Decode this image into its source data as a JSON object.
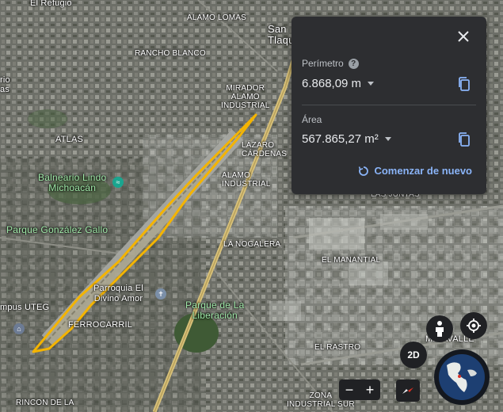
{
  "map_labels": {
    "el_refugio": "El Refugio",
    "alamo_lomas": "ALAMO LOMAS",
    "san_tlaque": "San\nTlaque",
    "rancho_blanco": "RANCHO BLANCO",
    "rio_left": "rio\nas",
    "mirador": "MIRADOR\nALAMO\nINDUSTRIAL",
    "atlas": "ATLAS",
    "lazaro": "LÁZARO\nCÁRDENAS",
    "alamo_industrial": "ALAMO\nINDUSTRIAL",
    "balneario": "Balneario Lindo\nMichoacán",
    "parque_gonzalez": "Parque González Gallo",
    "la_nogalera": "LA NOGALERA",
    "el_manantial": "EL MANANTIAL",
    "las_juntas": "LAS JUNTAS",
    "parroquia": "Parroquia El\nDivino Amor",
    "parque_liberacion": "Parque de La\nLiberación",
    "campus_uteg": "mpus UTEG",
    "ferrocarril": "FERROCARRIL",
    "miravalle": "MIRAVALLE",
    "el_rastro": "EL RASTRO",
    "zona_industrial": "ZONA\nINDUSTRIAL SUR",
    "rincon": "RINCON DE LA"
  },
  "measure_panel": {
    "perimeter_label": "Perímetro",
    "perimeter_value": "6.868,09 m",
    "area_label": "Área",
    "area_value": "567.865,27 m²",
    "restart_label": "Comenzar de nuevo",
    "help_symbol": "?"
  },
  "controls": {
    "mode_2d_label": "2D",
    "zoom_out": "−",
    "zoom_in": "+"
  },
  "colors": {
    "measure_line": "#f4b400",
    "panel_bg": "#2d2e31",
    "accent": "#8ab4f8"
  },
  "icons": {
    "close": "close-icon",
    "copy": "copy-icon",
    "restart": "restart-icon",
    "help": "help-icon",
    "pegman": "pegman-icon",
    "location": "my-location-icon",
    "compass": "compass-icon",
    "globe": "globe-icon"
  }
}
